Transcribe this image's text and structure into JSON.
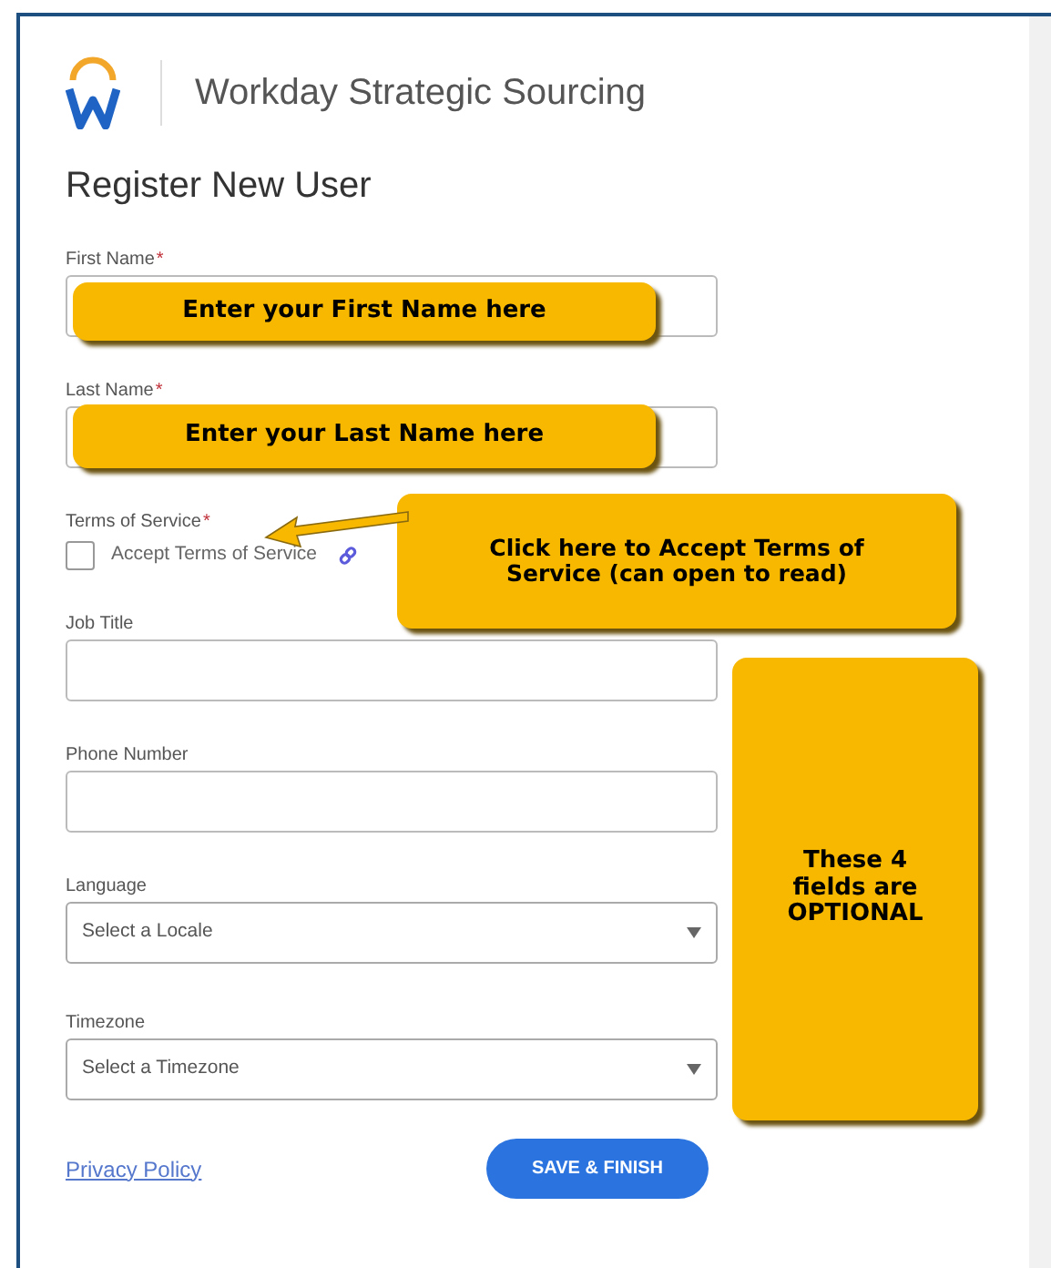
{
  "header": {
    "app_title": "Workday Strategic Sourcing"
  },
  "page_title": "Register New User",
  "fields": [
    {
      "kind": "text",
      "label": "First Name",
      "required_mark": "*"
    },
    {
      "kind": "text",
      "label": "Last Name",
      "required_mark": "*"
    },
    {
      "kind": "checkbox",
      "label": "Terms of Service",
      "required_mark": "*",
      "option": "Accept Terms of Service",
      "checked": false
    },
    {
      "kind": "text",
      "label": "Job Title"
    },
    {
      "kind": "text",
      "label": "Phone Number"
    },
    {
      "kind": "select",
      "label": "Language",
      "placeholder": "Select a Locale"
    },
    {
      "kind": "select",
      "label": "Timezone",
      "placeholder": "Select a Timezone"
    }
  ],
  "privacy_link": "Privacy Policy",
  "submit_button": "SAVE & FINISH",
  "callouts": [
    {
      "kind": "note",
      "text": "Enter your First Name here"
    },
    {
      "kind": "note",
      "text": "Enter your Last Name here"
    },
    {
      "kind": "arrow-note",
      "text": "Click here to Accept Terms of Service (can open to read)"
    },
    {
      "kind": "note",
      "text": "These 4 fields are OPTIONAL"
    }
  ]
}
